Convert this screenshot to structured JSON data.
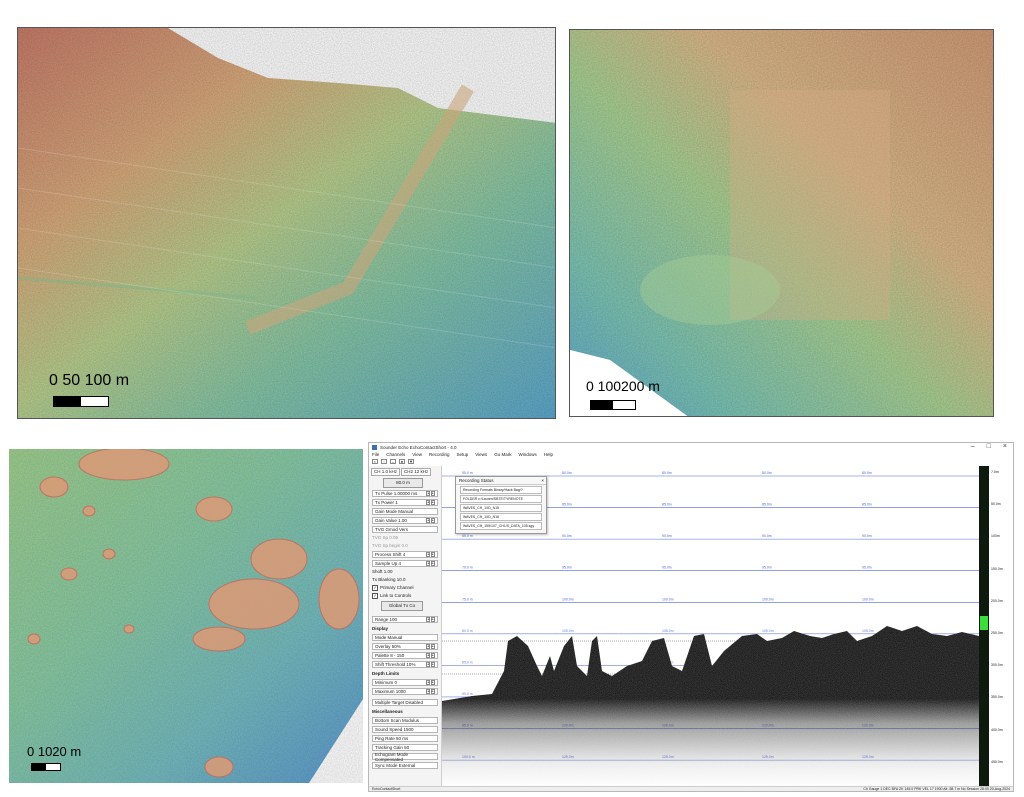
{
  "panels": {
    "top_left": {
      "scale": {
        "label": "0   50 100 m"
      }
    },
    "top_right": {
      "scale": {
        "label": "0  100200 m"
      }
    },
    "bottom_left": {
      "scale": {
        "label": "0 1020 m"
      }
    }
  },
  "echosounder": {
    "window_title": "Sounder Echo EchoContactShort - 4.0",
    "window_buttons": [
      "–",
      "□",
      "×"
    ],
    "menu": [
      "File",
      "Channels",
      "View",
      "Recording",
      "Setup",
      "Views",
      "Go Mark",
      "Windows",
      "Help"
    ],
    "left_pane": {
      "tabs": [
        "CH 1.0 kHz",
        "CH2 12 kHz"
      ],
      "range_field": "80.0 m",
      "controls": [
        {
          "label": "Tx Pulse  1.00000 ms"
        },
        {
          "label": "Tx Power  1"
        },
        {
          "label": "Gain Mode  Manual"
        },
        {
          "label": "Gain Value  1.00"
        },
        {
          "label": "TVG Gmod Vers"
        }
      ],
      "dim_rows": [
        "TVG  Sp  0.05",
        "TVG  Sp  begin  0.0"
      ],
      "more_controls": [
        {
          "label": "Process Shift  4"
        },
        {
          "label": "Sample Up  4"
        },
        {
          "label": "Shoft  1.00"
        },
        {
          "label": "Tx Blanking  10.0"
        }
      ],
      "checkboxes": [
        {
          "label": "Primary Channel",
          "checked": true
        },
        {
          "label": "Link to Controls",
          "checked": true
        }
      ],
      "global_button": "Global Tx Co",
      "range_row": "Range  100",
      "display_section": "Display",
      "display_rows": [
        "Mode  Manual",
        "Overlay  50%",
        "Palette  8 - 150",
        "Shift Threshold  10%"
      ],
      "depth_section": "Depth Limits",
      "depth_rows": [
        "Minimum  0",
        "Maximum  1000"
      ],
      "multiple_rows": "Multiple Target Disabled",
      "misc_section": "Miscellaneous",
      "misc_rows": [
        "Bottom Scan  Modulus",
        "Sound Speed  1500",
        "Ping Rate  50 ms",
        "Tracking Gain  50",
        "Echogram Mode  Compensated",
        "Sync Mode  External"
      ]
    },
    "recording_popup": {
      "title": "Recording Status",
      "rows": [
        "Recording Formats  Binary/Hack Bag/?",
        "FOLDER  c:/Lauren/SBTE/TYRENOTE",
        "WAVES_CH_1/ID_N15",
        "WAVES_CH_1/ID_N16",
        "WAVES_CH_155/107_CH1/S_DATA_105.sgy"
      ]
    },
    "echogram": {
      "depth_labels": [
        "55.0 m",
        "60.0 m",
        "65.0 m",
        "70.0 m",
        "75.0 m",
        "80.0 m",
        "85.0 m",
        "90.0 m",
        "95.0 m",
        "100.0 m"
      ],
      "grid_labels": [
        "80.0m",
        "85.0m",
        "90.0m",
        "95.0m",
        "100.0m",
        "105.0m",
        "110.0m",
        "115.0m",
        "120.0m",
        "125.0m"
      ],
      "colors": {
        "grid_line": "#4b67d8",
        "echo": "#000000",
        "background": "#ffffff"
      }
    },
    "depth_axis": [
      "7.0m",
      "50.0m",
      "100m",
      "150.0m",
      "200.0m",
      "250.0m",
      "300.0m",
      "350.0m",
      "400.0m",
      "450.0m"
    ],
    "status_bar": {
      "left": "EchoContactShort",
      "right": "Ch Gauge 1   DEC BFA   ZK 145.0 PRK  VEL  17 1900  Alt  -58.7 m   No Session   28:05   20-Aug-2024"
    }
  },
  "colors": {
    "bathy_deep": "#5aa6d6",
    "bathy_mid": "#8fc995",
    "bathy_shallow": "#d1a27b",
    "bathy_peak": "#c8665c"
  }
}
